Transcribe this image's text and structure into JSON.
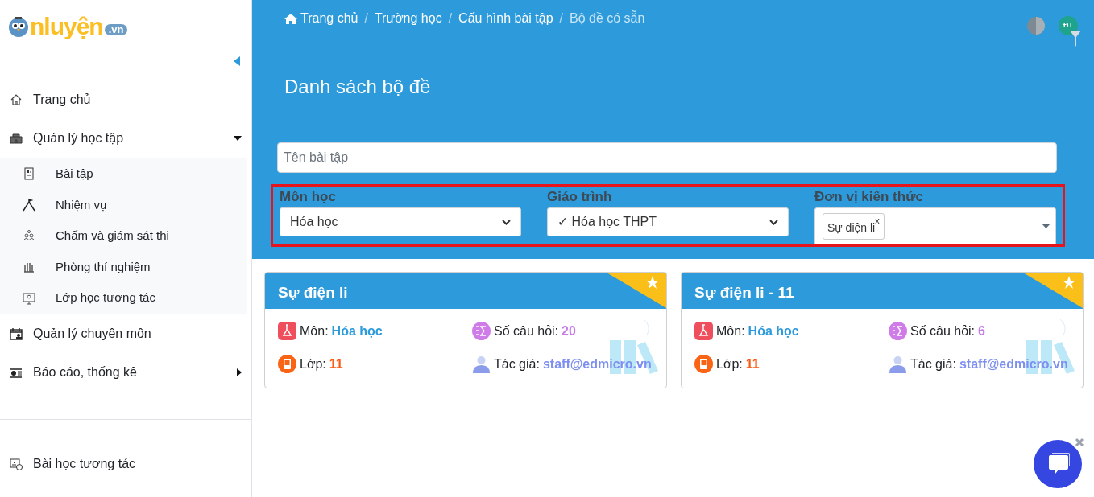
{
  "logo": {
    "text": "nluyện",
    "domain": ".vn"
  },
  "sidebar": {
    "items": [
      {
        "label": "Trang chủ",
        "kind": "home"
      },
      {
        "label": "Quản lý học tập",
        "kind": "school",
        "expanded": true,
        "children": [
          {
            "label": "Bài tập",
            "kind": "sheet"
          },
          {
            "label": "Nhiệm vụ",
            "kind": "mountain"
          },
          {
            "label": "Chấm và giám sát thi",
            "kind": "people"
          },
          {
            "label": "Phòng thí nghiệm",
            "kind": "lab"
          },
          {
            "label": "Lớp học tương tác",
            "kind": "screen"
          }
        ]
      },
      {
        "label": "Quản lý chuyên môn",
        "kind": "calendar"
      },
      {
        "label": "Báo cáo, thống kê",
        "kind": "report",
        "expanded": false
      }
    ],
    "bottom_items": [
      {
        "label": "Bài học tương tác",
        "kind": "lesson"
      }
    ]
  },
  "breadcrumb_separator": "/",
  "breadcrumbs": [
    {
      "label": "Trang chủ",
      "current": false,
      "home": true
    },
    {
      "label": "Trường học",
      "current": false,
      "home": false
    },
    {
      "label": "Cấu hình bài tập",
      "current": false,
      "home": false
    },
    {
      "label": "Bộ đề có sẵn",
      "current": true,
      "home": false
    }
  ],
  "user": {
    "initials": "ĐT"
  },
  "page_title": "Danh sách bộ đề",
  "search": {
    "placeholder": "Tên bài tập"
  },
  "filters_highlighted": true,
  "filters": [
    {
      "label": "Môn học",
      "kind": "select",
      "value": "Hóa học"
    },
    {
      "label": "Giáo trình",
      "kind": "select",
      "value": "✓ Hóa học THPT"
    },
    {
      "label": "Đơn vị kiến thức",
      "kind": "tags",
      "tags": [
        {
          "label": "Sự điện li",
          "remove": "x"
        }
      ]
    }
  ],
  "cards": [
    {
      "title": "Sự điện li",
      "starred": true,
      "subject_label": "Môn:",
      "subject": "Hóa học",
      "count_label": "Số câu hỏi:",
      "count": "20",
      "grade_label": "Lớp:",
      "grade": "11",
      "author_label": "Tác giả:",
      "author": "staff@edmicro.vn"
    },
    {
      "title": "Sự điện li - 11",
      "starred": true,
      "subject_label": "Môn:",
      "subject": "Hóa học",
      "count_label": "Số câu hỏi:",
      "count": "6",
      "grade_label": "Lớp:",
      "grade": "11",
      "author_label": "Tác giả:",
      "author": "staff@edmicro.vn"
    }
  ]
}
